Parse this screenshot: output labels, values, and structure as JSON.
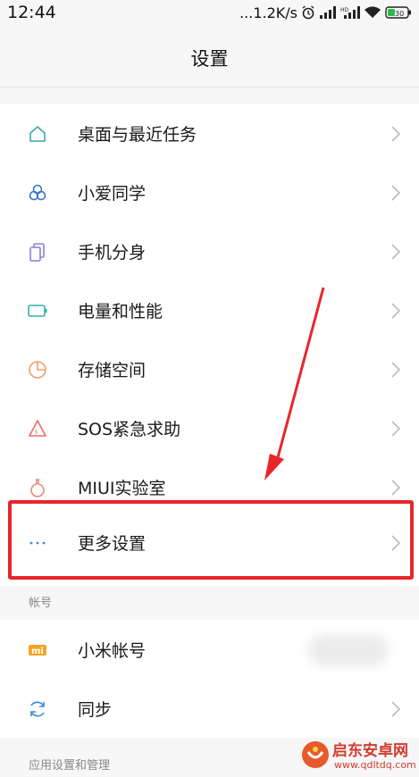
{
  "status_bar": {
    "time": "12:44",
    "net_speed": "...1.2K/s",
    "battery": "30"
  },
  "header": {
    "title": "设置"
  },
  "settings_items": [
    {
      "label": "桌面与最近任务",
      "icon": "home-icon"
    },
    {
      "label": "小爱同学",
      "icon": "xiaoai-icon"
    },
    {
      "label": "手机分身",
      "icon": "dual-phone-icon"
    },
    {
      "label": "电量和性能",
      "icon": "battery-icon"
    },
    {
      "label": "存储空间",
      "icon": "pie-storage-icon"
    },
    {
      "label": "SOS紧急求助",
      "icon": "sos-warning-icon"
    },
    {
      "label": "MIUI实验室",
      "icon": "flask-icon"
    },
    {
      "label": "更多设置",
      "icon": "more-dots-icon"
    }
  ],
  "account_section": {
    "header": "帐号",
    "items": [
      {
        "label": "小米帐号",
        "icon": "mi-logo-icon"
      },
      {
        "label": "同步",
        "icon": "sync-icon"
      }
    ]
  },
  "apps_section": {
    "header": "应用设置和管理"
  },
  "watermark": {
    "text": "启东安卓网",
    "url": "www.qdltdq.com"
  },
  "colors": {
    "accent_icon": "#3aa7a8",
    "highlight": "#e8262a",
    "watermark": "#d23b2e"
  }
}
